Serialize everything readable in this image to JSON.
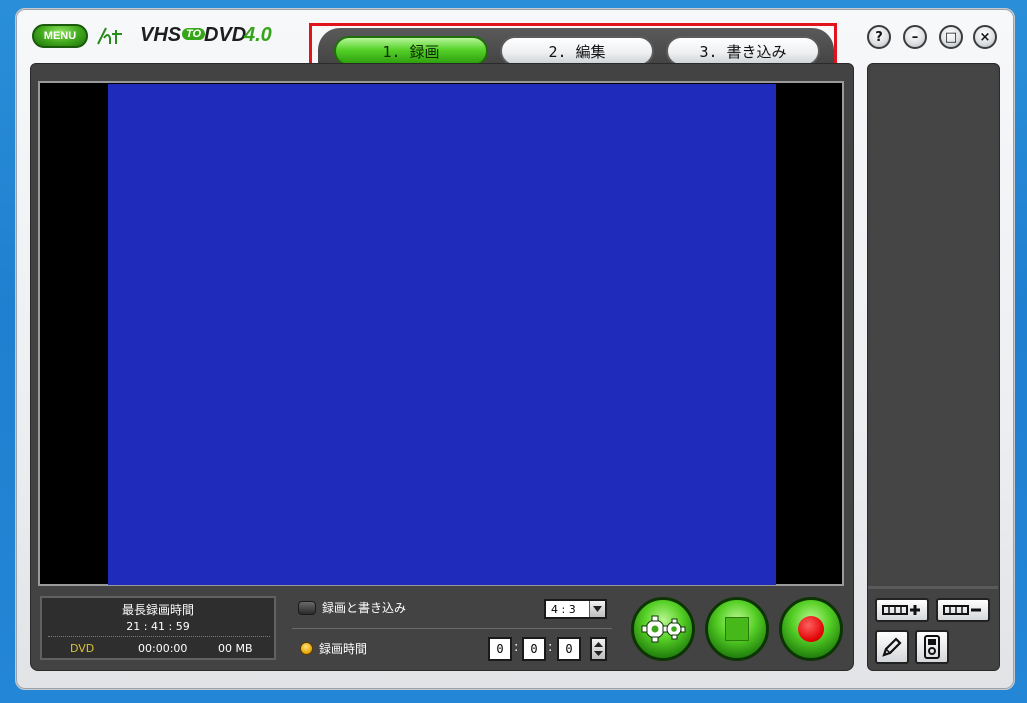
{
  "app": {
    "menu_label": "MENU",
    "logo_text_vhs": "VHS",
    "logo_text_to": "TO",
    "logo_text_dvd": "DVD",
    "logo_version": "4.0"
  },
  "tabs": [
    {
      "label": "1. 録画",
      "active": true
    },
    {
      "label": "2. 編集",
      "active": false
    },
    {
      "label": "3. 書き込み",
      "active": false
    }
  ],
  "window_buttons": {
    "help": "?",
    "minimize": "–",
    "maximize": "□",
    "close": "×"
  },
  "info": {
    "title": "最長録画時間",
    "max_time": "21 : 41 : 59",
    "format": "DVD",
    "elapsed": "00:00:00",
    "size": "00 MB"
  },
  "options": {
    "record_and_burn": "録画と書き込み",
    "record_time": "録画時間",
    "aspect_value": "4 : 3",
    "time_h": "0",
    "time_m": "0",
    "time_s": "0",
    "sep1": ":",
    "sep2": ":"
  },
  "colors": {
    "video_bg": "#1f2bbb",
    "accent_green": "#3fa51c",
    "highlight_red": "#e0141a"
  }
}
